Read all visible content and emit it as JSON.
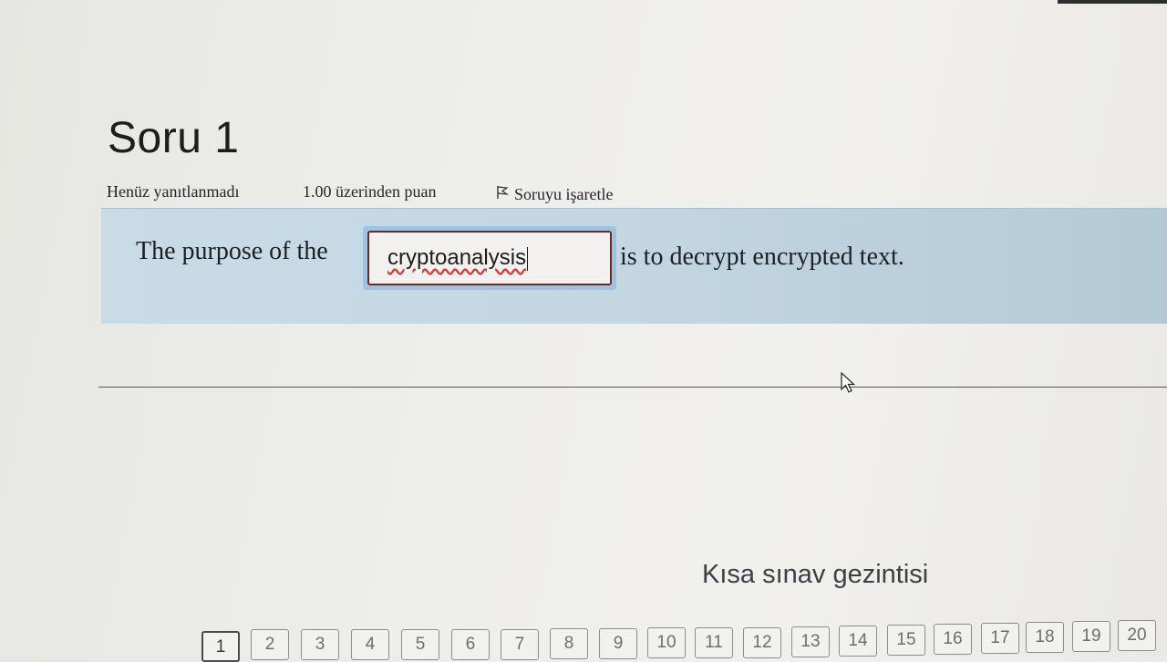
{
  "question": {
    "title": "Soru 1",
    "status": "Henüz yanıtlanmadı",
    "points": "1.00 üzerinden puan",
    "flag_label": "Soruyu işaretle",
    "text_before": "The purpose of the",
    "answer_value": "cryptoanalysis",
    "text_after": "is to decrypt encrypted text."
  },
  "navigation": {
    "title": "Kısa sınav gezintisi",
    "current": "1",
    "buttons": [
      "1",
      "2",
      "3",
      "4",
      "5",
      "6",
      "7",
      "8",
      "9",
      "10",
      "11",
      "12",
      "13",
      "14",
      "15",
      "16",
      "17",
      "18",
      "19",
      "20"
    ]
  },
  "colors": {
    "question_bg": "#c6d9e4",
    "input_border": "#6b2a2a",
    "focus_ring": "#9fc3de"
  },
  "icons": [
    "flag-icon",
    "mouse-cursor-icon"
  ]
}
